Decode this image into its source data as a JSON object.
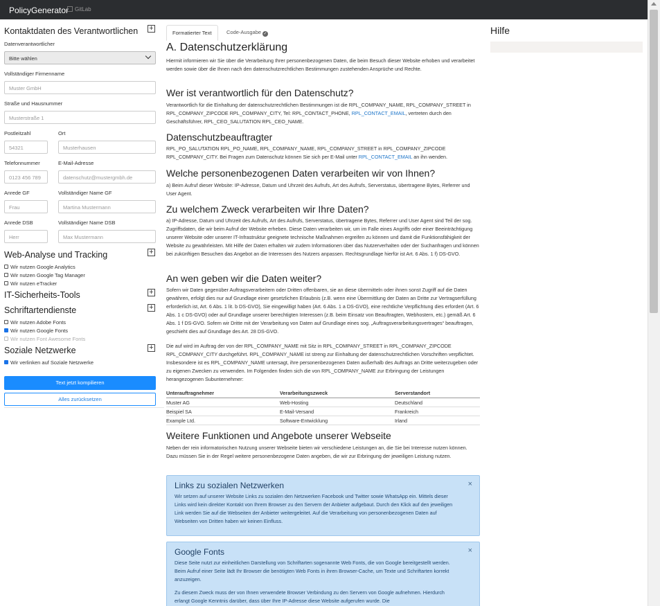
{
  "topbar": {
    "brand": "PolicyGenerator",
    "gitlab": "GitLab",
    "gitlab_icon": "gitlab-icon"
  },
  "sidebar": {
    "contact_title": "Kontaktdaten des Verantwortlichen",
    "responsible_label": "Datenverantwortlicher",
    "responsible_value": "Bitte wählen",
    "company_label": "Vollständiger Firmenname",
    "company_placeholder": "Muster GmbH",
    "street_label": "Straße und Hausnummer",
    "street_placeholder": "Musterstraße 1",
    "zip_label": "Postleitzahl",
    "zip_placeholder": "54321",
    "city_label": "Ort",
    "city_placeholder": "Musterhausen",
    "phone_label": "Telefonnummer",
    "phone_placeholder": "0123 456 789",
    "email_label": "E-Mail-Adresse",
    "email_placeholder": "datenschutz@mustergmbh.de",
    "salutation_md_label": "Anrede GF",
    "salutation_md_placeholder": "Frau",
    "name_md_label": "Vollständiger Name GF",
    "name_md_placeholder": "Martina Mustermann",
    "salutation_dpo_label": "Anrede DSB",
    "salutation_dpo_placeholder": "Herr",
    "name_dpo_label": "Vollständiger Name DSB",
    "name_dpo_placeholder": "Max Mustermann",
    "analytics_title": "Web-Analyse und Tracking",
    "analytics_options": [
      "Wir nutzen Google Analytics",
      "Wir nutzen Google Tag Manager",
      "Wir nutzen eTracker"
    ],
    "security_title": "IT-Sicherheits-Tools",
    "fonts_title": "Schriftartendienste",
    "fonts_options": [
      "Wir nutzen Adobe Fonts",
      "Wir nutzen Google Fonts",
      "Wir nutzen Font Awesome Fonts"
    ],
    "social_title": "Soziale Netzwerke",
    "social_options": [
      "Wir verlinken auf Soziale Netzwerke"
    ],
    "compile_button": "Text jetzt kompilieren",
    "reset_button": "Alles zurücksetzen"
  },
  "tabs": {
    "formatted": "Formatierter Text",
    "code": "Code-Ausgabe",
    "code_icon": "check-circle-icon"
  },
  "main": {
    "h_title": "A. Datenschutzerklärung",
    "p_intro": "Hiermit informieren wir Sie über die Verarbeitung Ihrer personenbezogenen Daten, die beim Besuch dieser Website erhoben und verarbeitet werden sowie über die Ihnen nach den datenschutzrechtlichen Bestimmungen zustehenden Ansprüche und Rechte.",
    "h_responsible": "Wer ist verantwortlich für den Datenschutz?",
    "p_responsible_a": "Verantwortlich für die Einhaltung der datenschutzrechtlichen Bestimmungen ist die RPL_COMPANY_NAME, RPL_COMPANY_STREET in RPL_COMPANY_ZIPCODE RPL_COMPANY_CITY, Tel: RPL_CONTACT_PHONE, ",
    "p_responsible_link": "RPL_CONTACT_EMAIL",
    "p_responsible_b": ", vertreten durch den Geschäftsführer, RPL_CEO_SALUTATION RPL_CEO_NAME.",
    "h_dpo": "Datenschutzbeauftragter",
    "p_dpo_a": "RPL_PO_SALUTATION RPL_PO_NAME, RPL_COMPANY_NAME, RPL_COMPANY_STREET in RPL_COMPANY_ZIPCODE RPL_COMPANY_CITY. Bei Fragen zum Datenschutz können Sie sich per E-Mail unter ",
    "p_dpo_link": "RPL_CONTACT_EMAIL",
    "p_dpo_b": " an ihn wenden.",
    "h_data": "Welche personenbezogenen Daten verarbeiten wir von Ihnen?",
    "p_data": "a) Beim Aufruf dieser Website: IP-Adresse, Datum und Uhrzeit des Aufrufs, Art des Aufrufs, Serverstatus, übertragene Bytes, Referrer und User Agent.",
    "h_purpose": "Zu welchem Zweck verarbeiten wir Ihre Daten?",
    "p_purpose": "a) IP-Adresse, Datum und Uhrzeit des Aufrufs, Art des Aufrufs, Serverstatus, übertragene Bytes, Referrer und User Agent sind Teil der sog. Zugriffsdaten, die wir beim Aufruf der Website erheben. Diese Daten verarbeiten wir, um im Falle eines Angriffs oder einer Beeinträchtigung unserer Website oder unserer IT-Infrastruktur geeignete technische Maßnahmen ergreifen zu können und damit die Funktionsfähigkeit der Website zu gewährleisten. Mit Hilfe der Daten erhalten wir zudem Informationen über das Nutzerverhalten oder der Suchanfragen und können bei zukünftigen Besuchen das Angebot an die Interessen des Nutzers anpassen. Rechtsgrundlage hierfür ist Art. 6 Abs. 1 f) DS-GVO.",
    "h_share": "An wen geben wir die Daten weiter?",
    "p_share": "Sofern wir Daten gegenüber Auftragsverarbeitern oder Dritten offenbaren, sie an diese übermitteln oder ihnen sonst Zugriff auf die Daten gewähren, erfolgt dies nur auf Grundlage einer gesetzlichen Erlaubnis (z.B. wenn eine Übermittlung der Daten an Dritte zur Vertragserfüllung erforderlich ist, Art. 6 Abs. 1 lit. b DS-GVO), Sie eingewilligt haben (Art. 6 Abs. 1 a DS-GVO), eine rechtliche Verpflichtung dies erfordert (Art. 6 Abs. 1 c DS-GVO) oder auf Grundlage unserer berechtigten Interessen (z.B. beim Einsatz von Beauftragten, Webhostern, etc.) gemäß Art. 6 Abs. 1 f DS-GVO. Sofern wir Dritte mit der Verarbeitung von Daten auf Grundlage eines sog. „Auftragsverarbeitungsvertrages“ beauftragen, geschieht dies auf Grundlage des Art. 28 DS-GVO.",
    "p_processor": "Die auf wird im Auftrag der von der RPL_COMPANY_NAME mit Sitz in RPL_COMPANY_STREET in RPL_COMPANY_ZIPCODE RPL_COMPANY_CITY durchgeführt. RPL_COMPANY_NAME ist streng zur Einhaltung der datenschutzrechtlichen Vorschriften verpflichtet. Insbesondere ist es RPL_COMPANY_NAME untersagt, ihre personenbezogenen Daten außerhalb des Auftrags an Dritte weiterzugeben oder zu eigenen Zwecken zu verwenden. Im Folgenden finden sich die von RPL_COMPANY_NAME zur Erbringung der Leistungen herangezogenen Subunternehmer:",
    "table": {
      "headers": [
        "Unterauftragnehmer",
        "Verarbeitungszweck",
        "Serverstandort"
      ],
      "rows": [
        [
          "Muster AG",
          "Web-Hosting",
          "Deutschland"
        ],
        [
          "Beispiel SA",
          "E-Mail-Versand",
          "Frankreich"
        ],
        [
          "Example Ltd.",
          "Software-Entwicklung",
          "Irland"
        ]
      ]
    },
    "h_more": "Weitere Funktionen und Angebote unserer Webseite",
    "p_more": "Neben der rein informatorischen Nutzung unserer Webseite bieten wir verschiedene Leistungen an, die Sie bei Interesse nutzen können. Dazu müssen Sie in der Regel weitere personenbezogene Daten angeben, die wir zur Erbringung der jeweiligen Leistung nutzen.",
    "alert_social": {
      "title": "Links zu sozialen Netzwerken",
      "close": "×",
      "text": "Wir setzen auf unserer Website Links zu sozialen den Netzwerken Facebook und Twitter sowie WhatsApp ein. Mittels dieser Links wird kein direkter Kontakt von Ihrem Browser zu den Servern der Anbieter aufgebaut. Durch den Klick auf den jeweiligen Link werden Sie auf die Webseiten der Anbieter weitergeleitet. Auf die Verarbeitung von personenbezogenen Daten auf Webseiten von Dritten haben wir keinen Einfluss."
    },
    "alert_fonts": {
      "title": "Google Fonts",
      "close": "×",
      "text": "Diese Seite nutzt zur einheitlichen Darstellung von Schriftarten sogenannte Web Fonts, die von Google bereitgestellt werden. Beim Aufruf einer Seite lädt Ihr Browser die benötigten Web Fonts in ihren Browser-Cache, um Texte und Schriftarten korrekt anzuzeigen.",
      "text2": "Zu diesem Zweck muss der von Ihnen verwendete Browser Verbindung zu den Servern von Google aufnehmen. Hierdurch erlangt Google Kenntnis darüber, dass über Ihre IP-Adresse diese Website aufgerufen wurde. Die"
    }
  },
  "help": {
    "title": "Hilfe"
  },
  "colors": {
    "primary": "#1a8cff",
    "topbar": "#2b2d30",
    "alert_bg": "#c8e1f7"
  }
}
